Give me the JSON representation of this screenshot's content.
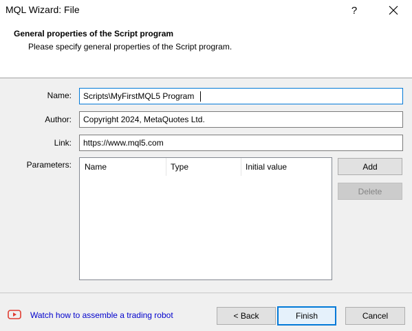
{
  "window": {
    "title": "MQL Wizard: File",
    "help_glyph": "?"
  },
  "header": {
    "title": "General properties of the Script program",
    "subtitle": "Please specify general properties of the Script program."
  },
  "form": {
    "name_label": "Name:",
    "name_value": "Scripts\\MyFirstMQL5 Program",
    "author_label": "Author:",
    "author_value": "Copyright 2024, MetaQuotes Ltd.",
    "link_label": "Link:",
    "link_value": "https://www.mql5.com",
    "parameters_label": "Parameters:"
  },
  "parameters_table": {
    "columns": [
      "Name",
      "Type",
      "Initial value"
    ],
    "rows": []
  },
  "buttons": {
    "add": "Add",
    "delete": "Delete",
    "back": "< Back",
    "finish": "Finish",
    "cancel": "Cancel"
  },
  "footer": {
    "watch_link": "Watch how to assemble a trading robot"
  },
  "icons": {
    "help": "help-icon",
    "close": "close-icon",
    "video": "video-play-icon"
  },
  "colors": {
    "accent": "#0078d7",
    "link": "#0000cc",
    "video_icon": "#e03c31"
  }
}
